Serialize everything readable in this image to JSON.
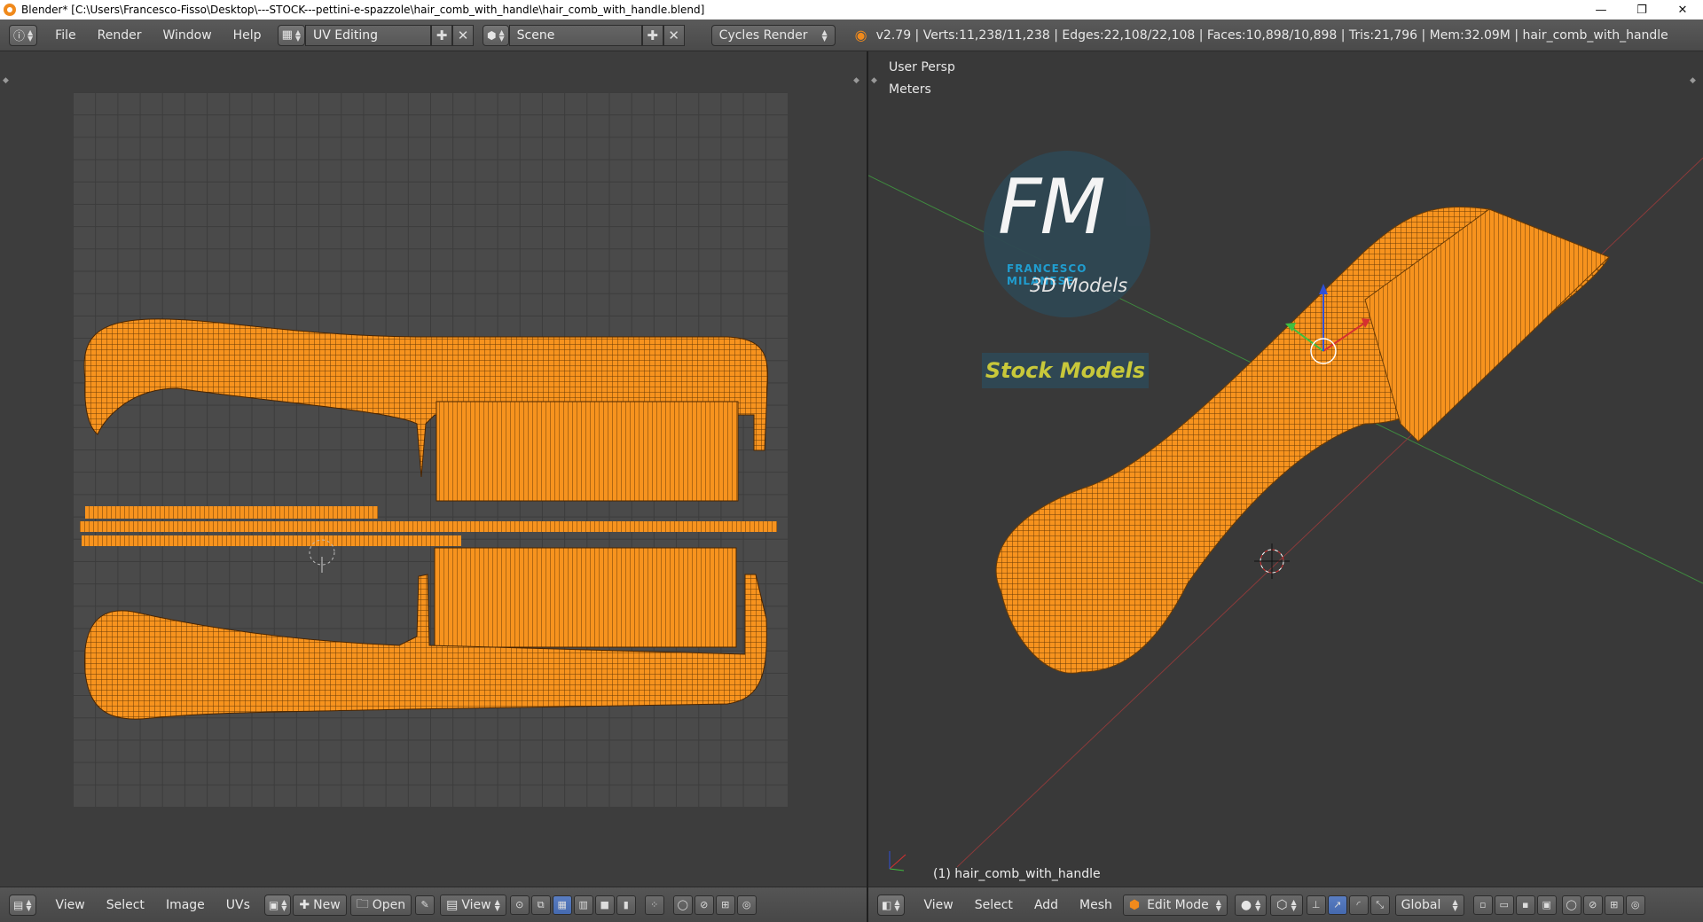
{
  "window": {
    "title": "Blender* [C:\\Users\\Francesco-Fisso\\Desktop\\---STOCK---pettini-e-spazzole\\hair_comb_with_handle\\hair_comb_with_handle.blend]",
    "minimize": "—",
    "restore": "❐",
    "close": "✕"
  },
  "menu": {
    "file": "File",
    "render": "Render",
    "window": "Window",
    "help": "Help"
  },
  "screen_layout": "UV Editing",
  "scene": "Scene",
  "render_engine": "Cycles Render",
  "stats": "v2.79 | Verts:11,238/11,238 | Edges:22,108/22,108 | Faces:10,898/10,898 | Tris:21,796 | Mem:32.09M | hair_comb_with_handle",
  "uv_footer": {
    "view": "View",
    "select": "Select",
    "image": "Image",
    "uvs": "UVs",
    "new": "New",
    "open": "Open",
    "view2": "View"
  },
  "view3d": {
    "perspective": "User Persp",
    "units": "Meters",
    "object_label": "(1) hair_comb_with_handle",
    "logo_initials": "FM",
    "logo_name": "FRANCESCO MILANESE",
    "logo_sub": "3D Models",
    "logo_banner": "Stock Models"
  },
  "footer_3d": {
    "view": "View",
    "select": "Select",
    "add": "Add",
    "mesh": "Mesh",
    "mode": "Edit Mode",
    "orientation": "Global"
  },
  "colors": {
    "mesh_orange": "#f7931e",
    "axis_red": "#c83a3a",
    "axis_green": "#3a9a3a",
    "logo_blue": "#1fa3d8",
    "banner_yellow": "#c8c83a"
  }
}
